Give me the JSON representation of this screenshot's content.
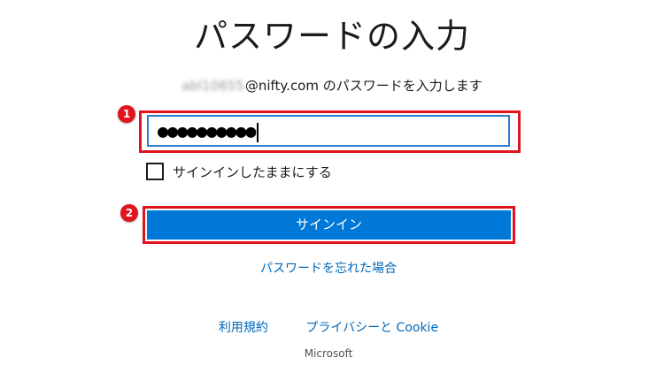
{
  "header": {
    "title": "パスワードの入力"
  },
  "account": {
    "user_blurred": "abl10655",
    "domain_and_prompt": "@nifty.com のパスワードを入力します"
  },
  "password_field": {
    "value": "●●●●●●●●●●"
  },
  "remember": {
    "label": "サインインしたままにする",
    "checked": false
  },
  "signin_button": {
    "label": "サインイン"
  },
  "forgot_link": {
    "label": "パスワードを忘れた場合"
  },
  "footer": {
    "terms": "利用規約",
    "privacy": "プライバシーと Cookie",
    "brand": "Microsoft"
  },
  "callouts": {
    "one": "1",
    "two": "2"
  },
  "colors": {
    "accent": "#0078d7",
    "link": "#0067b8",
    "highlight": "#e0141e"
  }
}
